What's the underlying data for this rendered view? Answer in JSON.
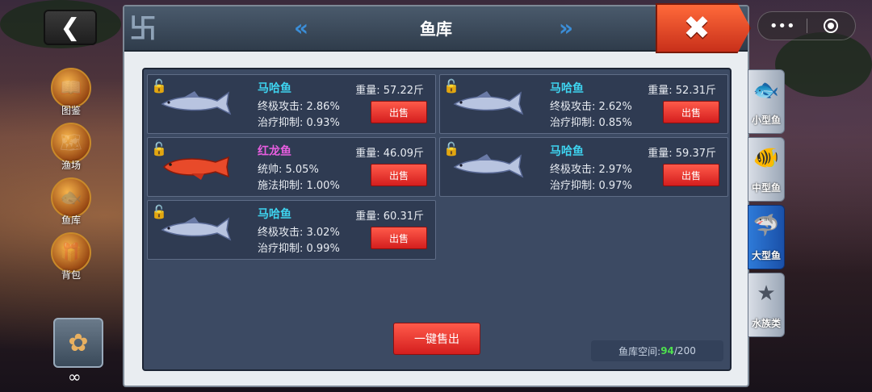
{
  "window": {
    "title": "鱼库"
  },
  "side_menu": [
    {
      "label": "图鉴",
      "icon": "book-icon"
    },
    {
      "label": "渔场",
      "icon": "map-icon"
    },
    {
      "label": "鱼库",
      "icon": "fishbowl-icon"
    },
    {
      "label": "背包",
      "icon": "bag-icon"
    }
  ],
  "close_button": {
    "label": "✖"
  },
  "fish": [
    {
      "name": "马哈鱼",
      "name_color": "#3ed4f0",
      "weight": "重量: 57.22斤",
      "stat1": "终极攻击: 2.86%",
      "stat2": "治疗抑制: 0.93%",
      "sell": "出售"
    },
    {
      "name": "马哈鱼",
      "name_color": "#3ed4f0",
      "weight": "重量: 52.31斤",
      "stat1": "终极攻击: 2.62%",
      "stat2": "治疗抑制: 0.85%",
      "sell": "出售"
    },
    {
      "name": "红龙鱼",
      "name_color": "#e85ee0",
      "weight": "重量: 46.09斤",
      "stat1": "统帅: 5.05%",
      "stat2": "施法抑制: 1.00%",
      "sell": "出售"
    },
    {
      "name": "马哈鱼",
      "name_color": "#3ed4f0",
      "weight": "重量: 59.37斤",
      "stat1": "终极攻击: 2.97%",
      "stat2": "治疗抑制: 0.97%",
      "sell": "出售"
    },
    {
      "name": "马哈鱼",
      "name_color": "#3ed4f0",
      "weight": "重量: 60.31斤",
      "stat1": "终极攻击: 3.02%",
      "stat2": "治疗抑制: 0.99%",
      "sell": "出售"
    }
  ],
  "sell_all": "一键售出",
  "capacity": {
    "label": "鱼库空间: ",
    "used": "94",
    "total": "/200"
  },
  "tabs": [
    {
      "label": "小型鱼",
      "active": false
    },
    {
      "label": "中型鱼",
      "active": false
    },
    {
      "label": "大型鱼",
      "active": true
    },
    {
      "label": "水族类",
      "active": false
    }
  ],
  "bottom_infinity": "∞",
  "colors": {
    "accent": "#2e7ad8",
    "sell_red": "#d41e1e",
    "capacity_used": "#4ee04e"
  }
}
